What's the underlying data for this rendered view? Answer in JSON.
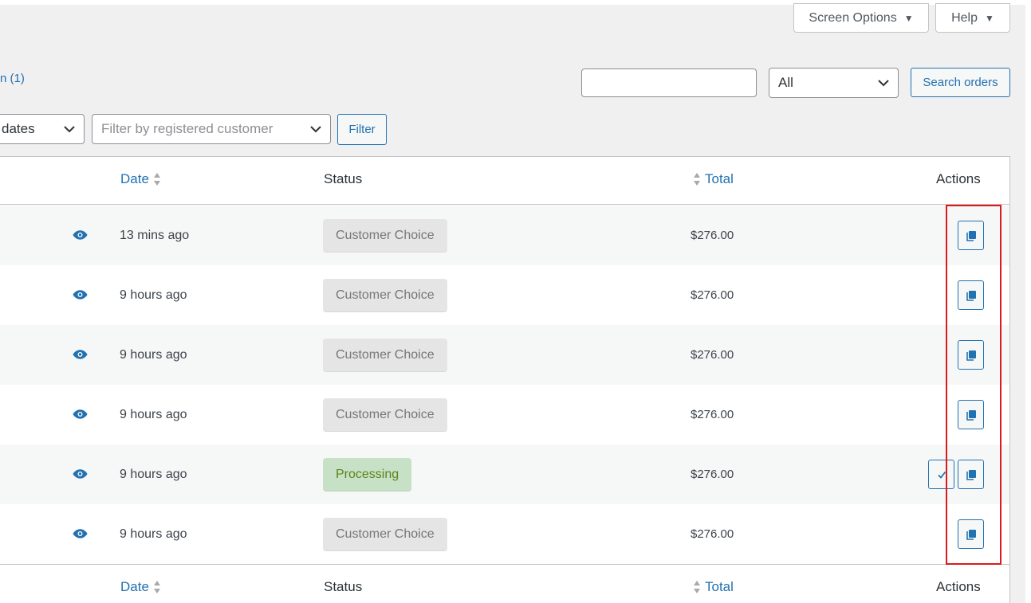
{
  "header": {
    "screen_options_label": "Screen Options",
    "help_label": "Help"
  },
  "views": {
    "visible_text": "n (1)"
  },
  "search": {
    "value": "",
    "placeholder": "",
    "type_select_value": "All",
    "button_label": "Search orders"
  },
  "filters": {
    "dates_select_value": "dates",
    "customer_select_placeholder": "Filter by registered customer",
    "filter_button_label": "Filter"
  },
  "table": {
    "columns": {
      "date": "Date",
      "status": "Status",
      "total": "Total",
      "actions": "Actions"
    },
    "rows": [
      {
        "date": "13 mins ago",
        "status": "Customer Choice",
        "status_type": "customer-choice",
        "total": "$276.00",
        "actions": [
          "copy"
        ]
      },
      {
        "date": "9 hours ago",
        "status": "Customer Choice",
        "status_type": "customer-choice",
        "total": "$276.00",
        "actions": [
          "copy"
        ]
      },
      {
        "date": "9 hours ago",
        "status": "Customer Choice",
        "status_type": "customer-choice",
        "total": "$276.00",
        "actions": [
          "copy"
        ]
      },
      {
        "date": "9 hours ago",
        "status": "Customer Choice",
        "status_type": "customer-choice",
        "total": "$276.00",
        "actions": [
          "copy"
        ]
      },
      {
        "date": "9 hours ago",
        "status": "Processing",
        "status_type": "processing",
        "total": "$276.00",
        "actions": [
          "complete",
          "copy"
        ]
      },
      {
        "date": "9 hours ago",
        "status": "Customer Choice",
        "status_type": "customer-choice",
        "total": "$276.00",
        "actions": [
          "copy"
        ]
      }
    ]
  },
  "icons": {
    "preview": "eye-icon",
    "copy": "copy-icon",
    "complete": "check-icon",
    "sort": "sort-icon",
    "dropdown": "chevron-down-icon"
  },
  "colors": {
    "accent": "#2271b1",
    "customer_choice_bg": "#e5e5e5",
    "customer_choice_text": "#777777",
    "processing_bg": "#c6e1c6",
    "processing_text": "#5b841b",
    "highlight_border": "#e0181b"
  }
}
